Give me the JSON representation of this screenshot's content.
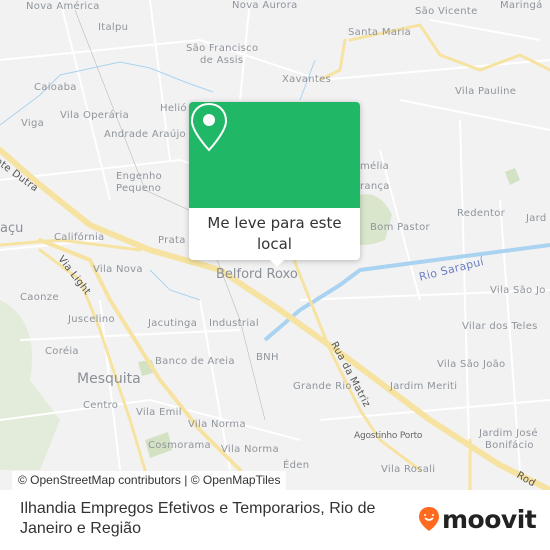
{
  "map": {
    "labels": {
      "nova_america": "Nova América",
      "italpu": "Italpu",
      "sao_francisco_1": "São Francisco",
      "sao_francisco_2": "de Assis",
      "caioaba": "Caioaba",
      "viga": "Viga",
      "vila_operaria": "Vila Operária",
      "andrade_araujo": "Andrade Araújo",
      "helio": "Helió",
      "engenho_1": "Engenho",
      "engenho_2": "Pequeno",
      "acu": "açu",
      "california": "Califórnia",
      "prata": "Prata",
      "vila_nova": "Vila Nova",
      "caonze": "Caonze",
      "juscelino": "Juscelino",
      "jacutinga": "Jacutinga",
      "industrial": "Industrial",
      "coreia": "Coréia",
      "banco_de_areia": "Banco de Areia",
      "bnh": "BNH",
      "mesquita": "Mesquita",
      "centro": "Centro",
      "vila_emil": "Vila Emil",
      "vila_norma_1": "Vila Norma",
      "cosmorama": "Cosmorama",
      "vila_norma_2": "Vila Norma",
      "belford_roxo": "Belford Roxo",
      "nova_top": "Nova Aurora",
      "sao_vicente": "São Vicente",
      "santa_maria": "Santa Maria",
      "xavantes": "Xavantes",
      "vila_pauline": "Vila Pauline",
      "melia": "mélia",
      "ranca": "rança",
      "bom_pastor": "Bom Pastor",
      "redentor": "Redentor",
      "jard": "Jard",
      "vila_sao_j": "Vila São Jo",
      "vilar_dos_teles": "Vilar dos Teles",
      "vila_sao_joao": "Vila São João",
      "jardim_meriti": "Jardim Meriti",
      "grande_rio": "Grande Rio",
      "agostinho_porto": "Agostinho Porto",
      "jardim_jose_1": "Jardim José",
      "jardim_jose_2": "Bonifácio",
      "vila_rosali": "Vila Rosali",
      "eden": "Éden",
      "maringa": "Maringá"
    },
    "roads": {
      "dutra": "ente Dutra",
      "via_light": "Via Light",
      "rua_da_matriz": "Rua da Matriz",
      "rod": "Rod"
    },
    "rivers": {
      "sarapui": "Rio Sarapuí"
    },
    "colors": {
      "background": "#f2f2f2",
      "major_road": "#f7e3a1",
      "water": "#a9d3f0",
      "park": "#d4e2c4"
    }
  },
  "popup": {
    "icon": "map-pin-icon",
    "color": "#20b866",
    "label": "Me leve para este local"
  },
  "attribution": "© OpenStreetMap contributors | © OpenMapTiles",
  "footer": {
    "title": "Ilhandia Empregos Efetivos e Temporarios, Rio de Janeiro e Região",
    "logo_text": "moovit",
    "logo_color": "#ff6a1f"
  }
}
